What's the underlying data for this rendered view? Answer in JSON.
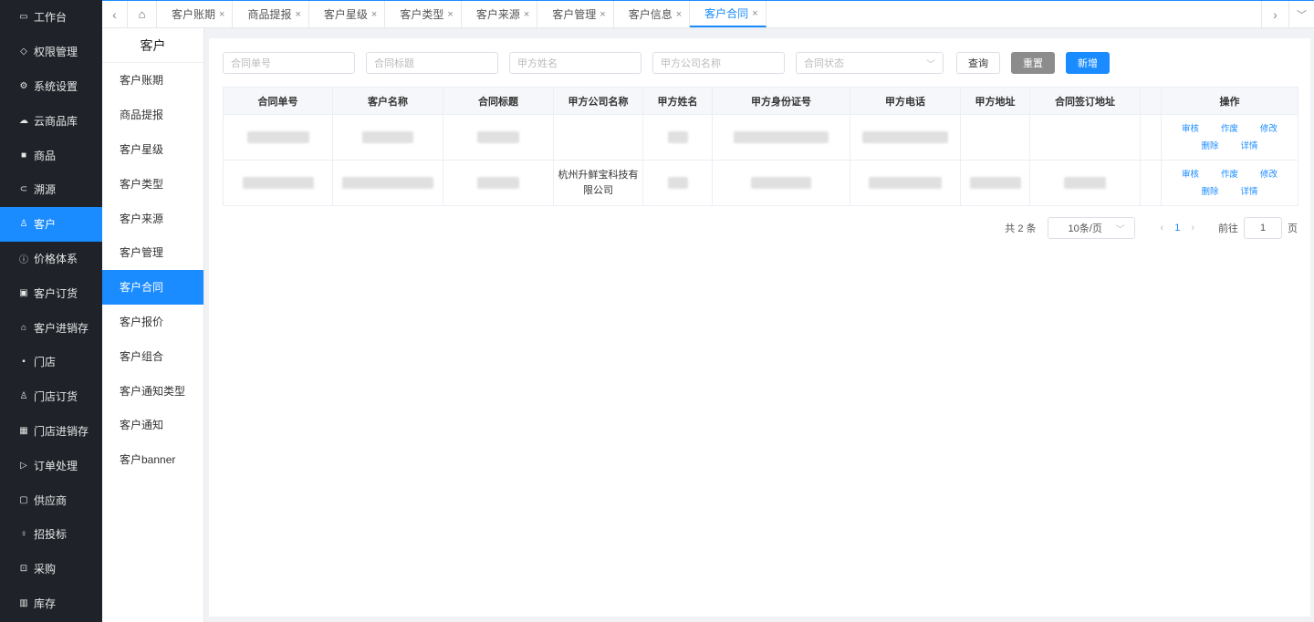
{
  "sidebar": {
    "items": [
      {
        "label": "工作台",
        "icon": "monitor-icon"
      },
      {
        "label": "权限管理",
        "icon": "shield-icon"
      },
      {
        "label": "系统设置",
        "icon": "gear-icon"
      },
      {
        "label": "云商品库",
        "icon": "cloud-icon"
      },
      {
        "label": "商品",
        "icon": "box-icon"
      },
      {
        "label": "溯源",
        "icon": "link-icon"
      },
      {
        "label": "客户",
        "icon": "users-icon",
        "active": true
      },
      {
        "label": "价格体系",
        "icon": "info-icon"
      },
      {
        "label": "客户订货",
        "icon": "order-icon"
      },
      {
        "label": "客户进销存",
        "icon": "bank-icon"
      },
      {
        "label": "门店",
        "icon": "store-icon"
      },
      {
        "label": "门店订货",
        "icon": "users-icon"
      },
      {
        "label": "门店进销存",
        "icon": "calculator-icon"
      },
      {
        "label": "订单处理",
        "icon": "send-icon"
      },
      {
        "label": "供应商",
        "icon": "chat-icon"
      },
      {
        "label": "招投标",
        "icon": "person-icon"
      },
      {
        "label": "采购",
        "icon": "cart-icon"
      },
      {
        "label": "库存",
        "icon": "table-icon"
      }
    ]
  },
  "tabs": {
    "items": [
      {
        "label": "客户账期"
      },
      {
        "label": "商品提报"
      },
      {
        "label": "客户星级"
      },
      {
        "label": "客户类型"
      },
      {
        "label": "客户来源"
      },
      {
        "label": "客户管理"
      },
      {
        "label": "客户信息"
      },
      {
        "label": "客户合同",
        "active": true
      }
    ],
    "close_glyph": "×"
  },
  "submenu": {
    "title": "客户",
    "items": [
      {
        "label": "客户账期"
      },
      {
        "label": "商品提报"
      },
      {
        "label": "客户星级"
      },
      {
        "label": "客户类型"
      },
      {
        "label": "客户来源"
      },
      {
        "label": "客户管理"
      },
      {
        "label": "客户合同",
        "active": true
      },
      {
        "label": "客户报价"
      },
      {
        "label": "客户组合"
      },
      {
        "label": "客户通知类型"
      },
      {
        "label": "客户通知"
      },
      {
        "label": "客户banner"
      }
    ]
  },
  "filters": {
    "contract_no_placeholder": "合同单号",
    "contract_title_placeholder": "合同标题",
    "party_a_name_placeholder": "甲方姓名",
    "party_a_company_placeholder": "甲方公司名称",
    "contract_status_placeholder": "合同状态",
    "query_label": "查询",
    "reset_label": "重置",
    "add_label": "新增"
  },
  "table": {
    "columns": [
      "合同单号",
      "客户名称",
      "合同标题",
      "甲方公司名称",
      "甲方姓名",
      "甲方身份证号",
      "甲方电话",
      "甲方地址",
      "合同签订地址",
      "操作"
    ],
    "rows": [
      {
        "company": "",
        "actions": [
          "审核",
          "作废",
          "修改",
          "删除",
          "详情"
        ]
      },
      {
        "company": "杭州升鲜宝科技有限公司",
        "actions": [
          "审核",
          "作废",
          "修改",
          "删除",
          "详情"
        ]
      }
    ]
  },
  "pagination": {
    "total_text": "共 2 条",
    "page_size": "10条/页",
    "current_page": "1",
    "goto_label": "前往",
    "goto_value": "1",
    "page_suffix": "页"
  },
  "colors": {
    "accent": "#1a8cff",
    "sidebar_bg": "#1f2329"
  }
}
